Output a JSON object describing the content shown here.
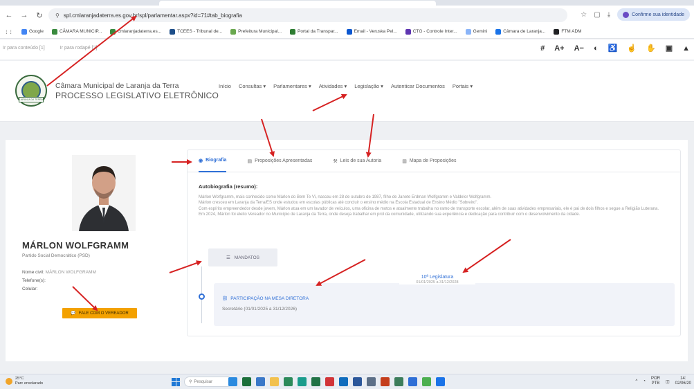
{
  "browser": {
    "url": "spl.cmlaranjadaterra.es.gov.br/spl/parlamentar.aspx?id=71#tab_biografia",
    "profile_label": "Confirme sua identidade",
    "bookmarks": [
      "Google",
      "CÂMARA MUNICIP...",
      "cmlaranjadaterra.es...",
      "TCEES - Tribunal de...",
      "Prefeitura Municipal...",
      "Portal da Transpar...",
      "Email - Veruska Pel...",
      "CTG - Controle Inter...",
      "Gemini",
      "Câmara de Laranja...",
      "FTM ADM"
    ]
  },
  "accessibility": {
    "skip_content": "Ir para conteúdo [1]",
    "skip_footer": "Ir para rodapé [2]",
    "icons": [
      "#",
      "A+",
      "A−",
      "◐",
      "♿",
      "☝",
      "✋",
      "▣",
      "▲"
    ]
  },
  "header": {
    "brand_line1": "Câmara Municipal de Laranja da Terra",
    "brand_line2": "PROCESSO LEGISLATIVO ELETRÔNICO",
    "logo_banner": "LARANJA DA TERRA",
    "nav": [
      "Início",
      "Consultas ▾",
      "Parlamentares ▾",
      "Atividades ▾",
      "Legislação ▾",
      "Autenticar Documentos",
      "Portais ▾"
    ]
  },
  "profile": {
    "name": "MÁRLON WOLFGRAMM",
    "party": "Partido Social Democrático (PSD)",
    "civil_name_label": "Nome civil:",
    "civil_name_value": "MÁRLON WOLFGRAMM",
    "phone_label": "Telefone(s):",
    "mobile_label": "Celular:",
    "talk_button": "FALE COM O VEREADOR"
  },
  "tabs": [
    "Biografia",
    "Proposições Apresentadas",
    "Leis de sua Autoria",
    "Mapa de Proposições"
  ],
  "bio": {
    "title": "Autobiografia (resumo):",
    "paragraphs": [
      "Márlon Wolfgramm, mais conhecido como Márlon do Bem Te Vi, nasceu em 28 de outubro de 1987, filho de Janete Erdman Wolfgramm e Valdelor Wolfgramm.",
      "Márlon cresceu em Laranja da Terra/ES onde estudou em escolas públicas até concluir o ensino médio na Escola Estadual de Ensino Médio \"Sobreiro\".",
      "Com espírito empreendedor desde jovem, Márlon atua em um lavador de veículos, uma oficina de motos e atualmente trabalha no ramo de transporte escolar, além de suas atividades empresariais, ele é pai de dois filhos e segue a Religião Luterana.",
      "Em 2024, Márlon foi eleito Vereador no Município de Laranja da Terra, onde deseja trabalhar em prol da comunidade, utilizando sua experiência e dedicação para contribuir com o desenvolvimento da cidade."
    ]
  },
  "mandatos": {
    "button": "MANDATOS",
    "legislature": "10ª Legislatura",
    "period": "01/01/2025 a 31/12/2028",
    "mesa_title": "PARTICIPAÇÃO NA MESA DIRETORA",
    "mesa_role": "Secretário (01/01/2025 a 31/12/2026)"
  },
  "taskbar": {
    "temp": "25°C",
    "weather": "Parc ensolarado",
    "search": "Pesquisar",
    "lang1": "POR",
    "lang2": "PTB",
    "time": "14:",
    "date": "02/06/20"
  },
  "colors": {
    "accent": "#2f6fd6",
    "button": "#f3a100",
    "annotation": "#d62222"
  }
}
